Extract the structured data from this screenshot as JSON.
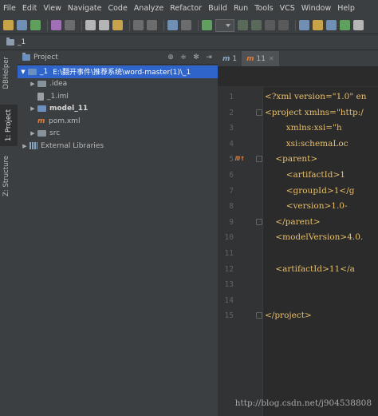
{
  "menu": [
    "File",
    "Edit",
    "View",
    "Navigate",
    "Code",
    "Analyze",
    "Refactor",
    "Build",
    "Run",
    "Tools",
    "VCS",
    "Window",
    "Help"
  ],
  "nav": {
    "breadcrumb": "_1"
  },
  "sidebar": {
    "tabs": [
      "DBHelper",
      "1: Project",
      "Z: Structure"
    ]
  },
  "project_panel": {
    "title": "Project",
    "root": {
      "name": "_1",
      "path": "E:\\翻开事件\\推荐系统\\word-master(1)\\_1"
    },
    "items": [
      {
        "label": ".idea",
        "kind": "folder"
      },
      {
        "label": "_1.iml",
        "kind": "file"
      },
      {
        "label": "model_11",
        "kind": "module"
      },
      {
        "label": "pom.xml",
        "kind": "maven"
      },
      {
        "label": "src",
        "kind": "folder"
      },
      {
        "label": "External Libraries",
        "kind": "libraries"
      }
    ]
  },
  "editor": {
    "tabs": [
      {
        "icon": "m",
        "label": "1"
      },
      {
        "icon": "m",
        "label": "11"
      }
    ],
    "lines": [
      {
        "n": "1",
        "text": "<?xml version=\"1.0\" en"
      },
      {
        "n": "2",
        "text": "<project xmlns=\"http:/"
      },
      {
        "n": "3",
        "text": "        xmlns:xsi=\"h"
      },
      {
        "n": "4",
        "text": "        xsi:schemaLoc"
      },
      {
        "n": "5",
        "text": "    <parent>",
        "marker": "m↑"
      },
      {
        "n": "6",
        "text": "        <artifactId>1"
      },
      {
        "n": "7",
        "text": "        <groupId>1</g"
      },
      {
        "n": "8",
        "text": "        <version>1.0-"
      },
      {
        "n": "9",
        "text": "    </parent>"
      },
      {
        "n": "10",
        "text": "    <modelVersion>4.0."
      },
      {
        "n": "11",
        "text": ""
      },
      {
        "n": "12",
        "text": "    <artifactId>11</a"
      },
      {
        "n": "13",
        "text": ""
      },
      {
        "n": "14",
        "text": ""
      },
      {
        "n": "15",
        "text": "</project>"
      }
    ]
  },
  "watermark": "http://blog.csdn.net/j904538808"
}
